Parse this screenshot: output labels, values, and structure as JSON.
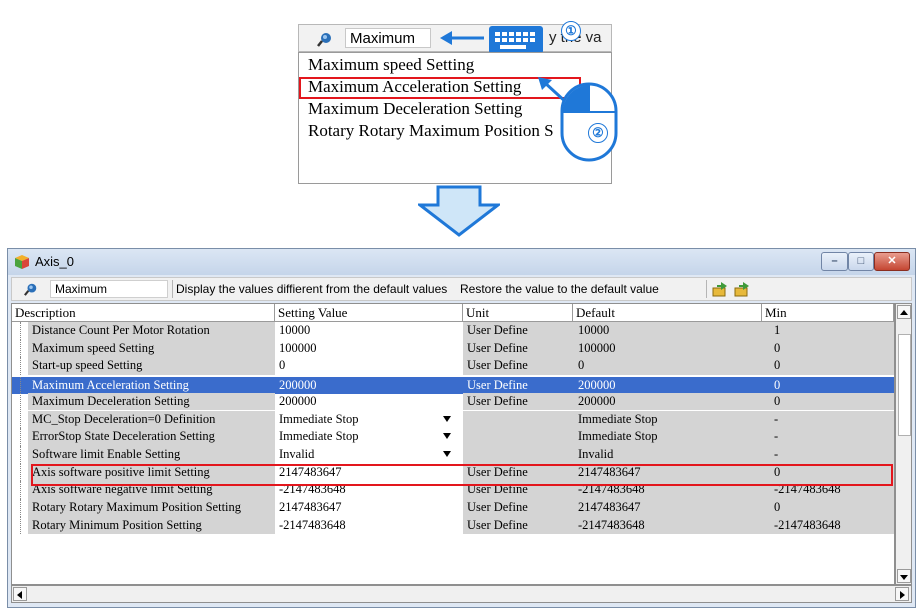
{
  "callout": {
    "search_value": "Maximum",
    "obscured_text": "y the va",
    "step1": "①",
    "step2": "②",
    "dropdown_items": [
      "Maximum speed Setting",
      "Maximum Acceleration Setting",
      "Maximum Deceleration Setting",
      "Rotary Rotary Maximum Position S"
    ]
  },
  "window": {
    "title": "Axis_0",
    "buttons": {
      "minimize": "–",
      "maximize": "□",
      "close": "✕"
    }
  },
  "toolbar": {
    "search_value": "Maximum",
    "diff_label": "Display the values diffierent from the default values",
    "restore_label": "Restore the value to the default value"
  },
  "table": {
    "columns": [
      "Description",
      "Setting Value",
      "Unit",
      "Default",
      "Min"
    ],
    "rows": [
      {
        "desc": "Distance Count Per Motor Rotation",
        "value": "10000",
        "unit": "User Define",
        "default": "10000",
        "min": "1"
      },
      {
        "desc": "Maximum speed Setting",
        "value": "100000",
        "unit": "User Define",
        "default": "100000",
        "min": "0"
      },
      {
        "desc": "Start-up speed Setting",
        "value": "0",
        "unit": "User Define",
        "default": "0",
        "min": "0"
      },
      {
        "desc": "Maximum Acceleration Setting",
        "value": "200000",
        "unit": "User Define",
        "default": "200000",
        "min": "0"
      },
      {
        "desc": "Maximum Deceleration Setting",
        "value": "200000",
        "unit": "User Define",
        "default": "200000",
        "min": "0"
      },
      {
        "desc": "MC_Stop Deceleration=0 Definition",
        "value": "Immediate Stop",
        "unit": "",
        "default": "Immediate Stop",
        "min": "-"
      },
      {
        "desc": "ErrorStop State Deceleration Setting",
        "value": "Immediate Stop",
        "unit": "",
        "default": "Immediate Stop",
        "min": "-"
      },
      {
        "desc": "Software limit Enable Setting",
        "value": "Invalid",
        "unit": "",
        "default": "Invalid",
        "min": "-"
      },
      {
        "desc": "Axis software positive limit Setting",
        "value": "2147483647",
        "unit": "User Define",
        "default": "2147483647",
        "min": "0"
      },
      {
        "desc": "Axis software negative limit Setting",
        "value": "-2147483648",
        "unit": "User Define",
        "default": "-2147483648",
        "min": "-2147483648"
      },
      {
        "desc": "Rotary Rotary Maximum Position Setting",
        "value": "2147483647",
        "unit": "User Define",
        "default": "2147483647",
        "min": "0"
      },
      {
        "desc": "Rotary Minimum Position Setting",
        "value": "-2147483648",
        "unit": "User Define",
        "default": "-2147483648",
        "min": "-2147483648"
      }
    ]
  },
  "colors": {
    "highlight": "#e3161d",
    "selection": "#3a6ccc",
    "accent_blue": "#1f78d8"
  }
}
